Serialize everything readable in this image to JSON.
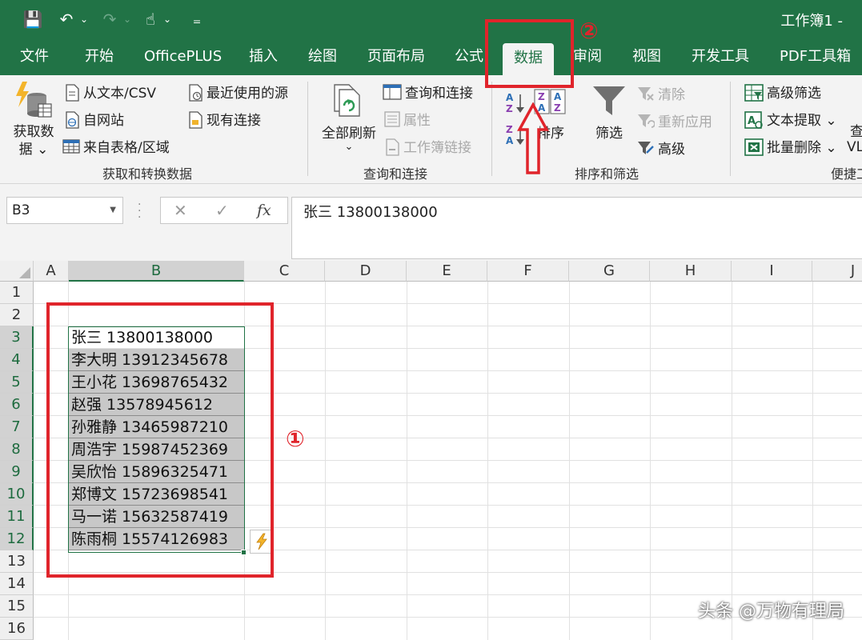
{
  "titlebar": {
    "doc_title": "工作簿1 -",
    "qat": {
      "save": "💾",
      "undo": "↶",
      "redo": "↷",
      "touch": "☝",
      "customize": "₌",
      "caret": "⌄"
    }
  },
  "tabs": [
    {
      "label": "文件",
      "active": false
    },
    {
      "label": "开始",
      "active": false
    },
    {
      "label": "OfficePLUS",
      "active": false
    },
    {
      "label": "插入",
      "active": false
    },
    {
      "label": "绘图",
      "active": false
    },
    {
      "label": "页面布局",
      "active": false
    },
    {
      "label": "公式",
      "active": false
    },
    {
      "label": "数据",
      "active": true
    },
    {
      "label": "审阅",
      "active": false
    },
    {
      "label": "视图",
      "active": false
    },
    {
      "label": "开发工具",
      "active": false
    },
    {
      "label": "PDF工具箱",
      "active": false
    }
  ],
  "ribbon": {
    "get_transform": {
      "get_data_label": "获取数\n据 ⌄",
      "from_text_csv": "从文本/CSV",
      "from_web": "自网站",
      "from_table": "来自表格/区域",
      "recent_sources": "最近使用的源",
      "existing_connections": "现有连接",
      "group_label": "获取和转换数据"
    },
    "queries": {
      "refresh_all": "全部刷新",
      "refresh_caret": "⌄",
      "queries_connections": "查询和连接",
      "properties": "属性",
      "workbook_links": "工作簿链接",
      "group_label": "查询和连接"
    },
    "sort_filter": {
      "sort_az": "A↓Z",
      "sort_za": "Z↓A",
      "sort": "排序",
      "filter": "筛选",
      "clear": "清除",
      "reapply": "重新应用",
      "advanced": "高级",
      "group_label": "排序和筛选"
    },
    "tools": {
      "advanced_filter": "高级筛选",
      "text_extract": "文本提取 ⌄",
      "batch_delete": "批量删除 ⌄",
      "check_partial": "查",
      "vl_partial": "VL",
      "group_label": "便捷工"
    }
  },
  "formula_bar": {
    "name_box": "B3",
    "cancel": "✕",
    "enter": "✓",
    "fx": "fx",
    "value": "张三 13800138000"
  },
  "sheet": {
    "columns": [
      "A",
      "B",
      "C",
      "D",
      "E",
      "F",
      "G",
      "H",
      "I",
      "J"
    ],
    "rows": [
      "1",
      "2",
      "3",
      "4",
      "5",
      "6",
      "7",
      "8",
      "9",
      "10",
      "11",
      "12",
      "13",
      "14",
      "15",
      "16"
    ],
    "cells_b": [
      "张三 13800138000",
      "李大明 13912345678",
      "王小花 13698765432",
      "赵强 13578945612",
      "孙雅静 13465987210",
      "周浩宇 15987452369",
      "吴欣怡 15896325471",
      "郑博文 15723698541",
      "马一诺 15632587419",
      "陈雨桐 15574126983"
    ]
  },
  "annotations": {
    "one": "①",
    "two": "②"
  },
  "watermark": "头条 @万物有理局",
  "colors": {
    "excel_green": "#217346",
    "annotation_red": "#e0242b"
  }
}
